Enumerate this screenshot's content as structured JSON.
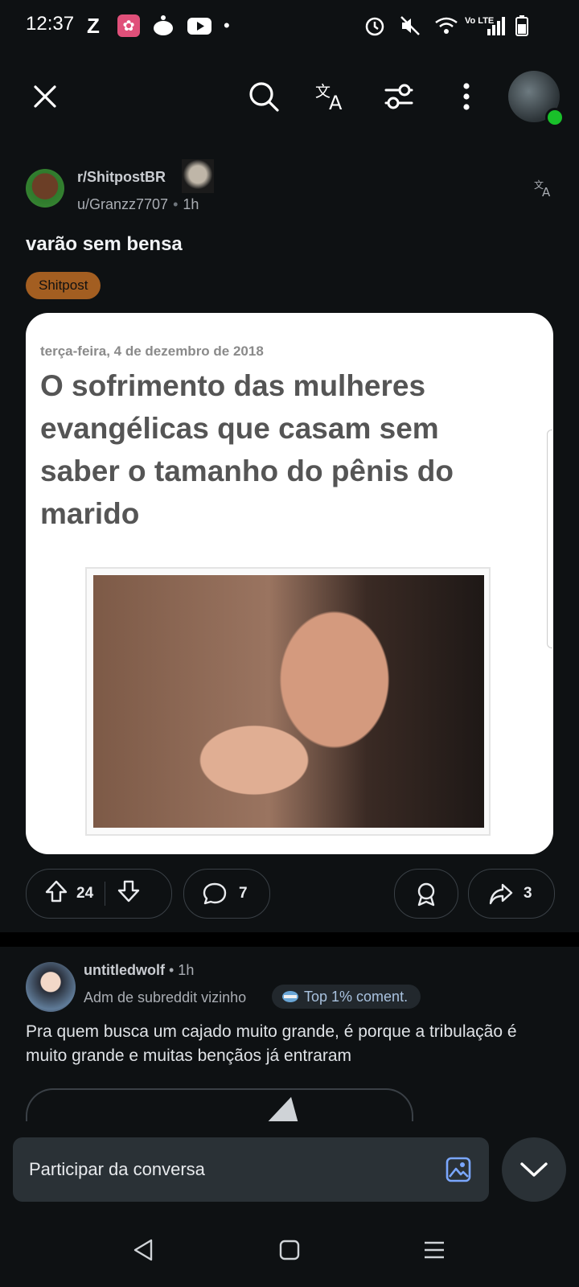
{
  "status_bar": {
    "time": "12:37",
    "network_label": "Vo LTE",
    "icons": [
      "z-app-icon",
      "flower-app-icon",
      "reddit-icon",
      "youtube-icon",
      "dot-icon",
      "alarm-icon",
      "mute-icon",
      "wifi-icon",
      "signal-icon",
      "battery-icon"
    ]
  },
  "toolbar": {
    "icons": [
      "close-icon",
      "search-icon",
      "translate-icon",
      "filter-icon",
      "more-icon",
      "profile-avatar"
    ]
  },
  "post": {
    "subreddit": "r/ShitpostBR",
    "author": "u/Granzz7707",
    "separator": "•",
    "age": "1h",
    "title": "varão sem bensa",
    "flair": "Shitpost",
    "image": {
      "date": "terça-feira, 4 de dezembro de 2018",
      "headline": "O sofrimento das mulheres evangélicas que casam sem saber o tamanho do pênis do marido"
    },
    "actions": {
      "upvotes": "24",
      "comments": "7",
      "shares": "3"
    }
  },
  "comment": {
    "author": "untitledwolf",
    "age": "• 1h",
    "role": "Adm de subreddit vizinho",
    "badge": "Top 1% coment.",
    "text": "Pra quem busca um cajado muito grande, é porque a tribulação é muito grande e muitas bençãos já entraram"
  },
  "reply": {
    "placeholder": "Participar da conversa"
  },
  "colors": {
    "background": "#0e1113",
    "flair": "#a35e21",
    "online": "#19c02a",
    "image_icon": "#7aa7ff"
  }
}
